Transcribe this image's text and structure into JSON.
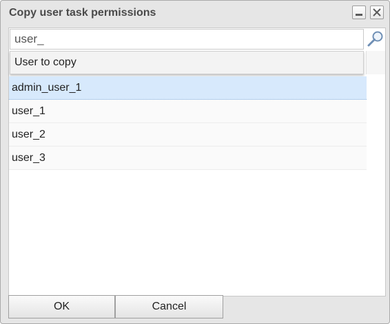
{
  "dialog": {
    "title": "Copy user task permissions"
  },
  "icons": {
    "minimize": "minimize-icon",
    "close": "close-icon",
    "search": "magnifier-icon"
  },
  "search": {
    "value": "user_"
  },
  "dropdown": {
    "item_label": "User to copy"
  },
  "users": {
    "items": [
      {
        "label": "admin_user_1",
        "selected": true
      },
      {
        "label": "user_1",
        "selected": false
      },
      {
        "label": "user_2",
        "selected": false
      },
      {
        "label": "user_3",
        "selected": false
      }
    ]
  },
  "buttons": {
    "ok_label": "OK",
    "cancel_label": "Cancel"
  }
}
